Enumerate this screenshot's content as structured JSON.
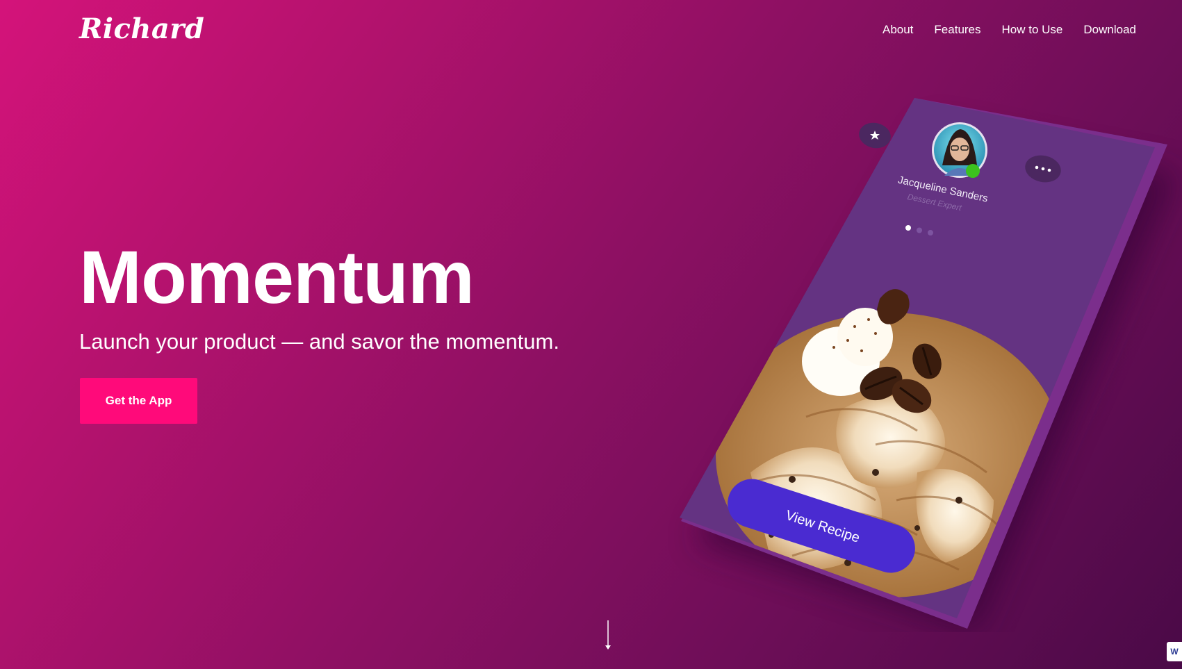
{
  "brand": {
    "logo": "Richard"
  },
  "nav": {
    "items": [
      "About",
      "Features",
      "How to Use",
      "Download"
    ]
  },
  "hero": {
    "title": "Momentum",
    "tagline": "Launch your product — and savor the momentum.",
    "cta_label": "Get the App"
  },
  "phone": {
    "profile_name": "Jacqueline Sanders",
    "profile_role": "Dessert Expert",
    "button_label": "View Recipe",
    "carousel": {
      "total": 3,
      "active": 1
    }
  },
  "badge": {
    "label": "W"
  },
  "colors": {
    "cta": "#ff0a7a",
    "phone_screen": "#643382",
    "recipe_button": "#4a2bd1",
    "online_status": "#3cc21e"
  },
  "icons": [
    "star-icon",
    "more-icon",
    "arrow-down-icon"
  ]
}
